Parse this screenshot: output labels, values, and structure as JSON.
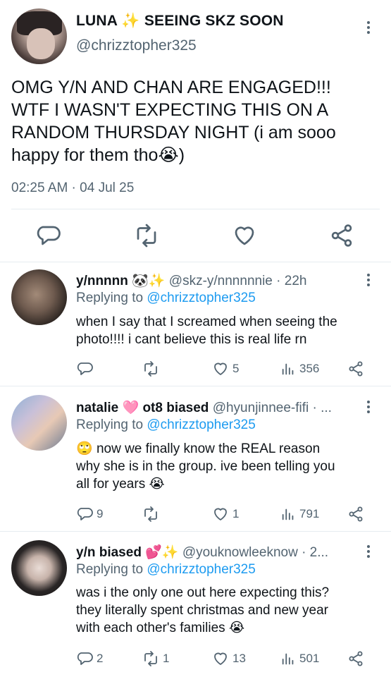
{
  "colors": {
    "text": "#0f1419",
    "secondary": "#536471",
    "link": "#1d9bf0",
    "divider": "#e6ecf0",
    "sparkle": "#f4b400",
    "heart_emoji": "#ff6fb3"
  },
  "main_tweet": {
    "name": "LUNA",
    "name_suffix": "SEEING SKZ SOON",
    "name_emoji": "✨",
    "handle": "@chrizztopher325",
    "text_line1": "OMG Y/N AND CHAN ARE ENGAGED!!!",
    "text_line2": "WTF I WASN'T EXPECTING THIS ON A",
    "text_line3": "RANDOM THURSDAY NIGHT (i am sooo",
    "text_line4_start": "happy for them tho",
    "text_line4_emoji": "😭",
    "text_line4_end": ")",
    "timestamp": "02:25 AM · 04 Jul 25",
    "icons": [
      "reply-icon",
      "retweet-icon",
      "like-icon",
      "share-icon"
    ]
  },
  "replies": [
    {
      "name": "y/nnnnn",
      "name_emojis": "🐼✨",
      "handle_time": "@skz-y/nnnnnnie · 22h",
      "replying_prefix": "Replying to ",
      "replying_handle": "@chrizztopher325",
      "line1": "when I say that I screamed when seeing the",
      "line2": "photo!!!! i cant believe this is real life rn",
      "reply_count": "",
      "retweet_count": "",
      "like_count": "5",
      "view_count": "356"
    },
    {
      "name": "natalie",
      "name_emoji": "🩷",
      "name_suffix": "ot8 biased",
      "handle_time": "@hyunjinnee-fifi · ...",
      "replying_prefix": "Replying to ",
      "replying_handle": "@chrizztopher325",
      "line1_emoji": "🙄",
      "line1": "now we finally know the REAL reason",
      "line2": "why she is in the group. ive been telling you",
      "line3": "all for years",
      "line3_emoji": "😭",
      "reply_count": "9",
      "retweet_count": "",
      "like_count": "1",
      "view_count": "791"
    },
    {
      "name": "y/n biased",
      "name_emojis": "💕✨",
      "handle_time": "@youknowleeknow · 2...",
      "replying_prefix": "Replying to ",
      "replying_handle": "@chrizztopher325",
      "line1": "was i the only one out here expecting this?",
      "line2": "they literally spent christmas and new year",
      "line3": "with each other's families",
      "line3_emoji": "😭",
      "reply_count": "2",
      "retweet_count": "1",
      "like_count": "13",
      "view_count": "501"
    }
  ]
}
